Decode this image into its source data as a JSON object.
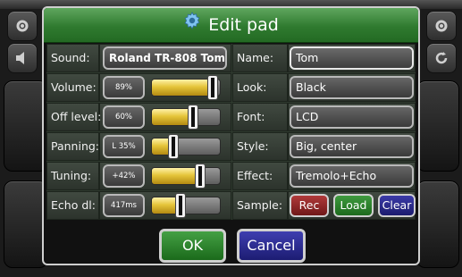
{
  "dialog": {
    "title": "Edit pad",
    "title_icon": "gear-icon",
    "colors": {
      "title_bar": "#2f7a2f",
      "slider_fill": "#e5c53a",
      "rec": "#b03a3a",
      "load": "#2e8a2e",
      "clear": "#2e2e9a"
    }
  },
  "left": {
    "sound": {
      "label": "Sound:",
      "value": "Roland TR-808 Tom"
    },
    "volume": {
      "label": "Volume:",
      "value": "89%",
      "level": 0.89
    },
    "off_level": {
      "label": "Off level:",
      "value": "60%",
      "level": 0.6
    },
    "panning": {
      "label": "Panning:",
      "value": "L 35%",
      "level": 0.325
    },
    "tuning": {
      "label": "Tuning:",
      "value": "+42%",
      "level": 0.71
    },
    "echo": {
      "label": "Echo dl:",
      "value": "417ms",
      "level": 0.42
    }
  },
  "right": {
    "name": {
      "label": "Name:",
      "value": "Tom"
    },
    "look": {
      "label": "Look:",
      "value": "Black"
    },
    "font": {
      "label": "Font:",
      "value": "LCD"
    },
    "style": {
      "label": "Style:",
      "value": "Big, center"
    },
    "effect": {
      "label": "Effect:",
      "value": "Tremolo+Echo"
    },
    "sample": {
      "label": "Sample:",
      "rec": "Rec",
      "load": "Load",
      "clear": "Clear"
    }
  },
  "footer": {
    "ok": "OK",
    "cancel": "Cancel"
  }
}
